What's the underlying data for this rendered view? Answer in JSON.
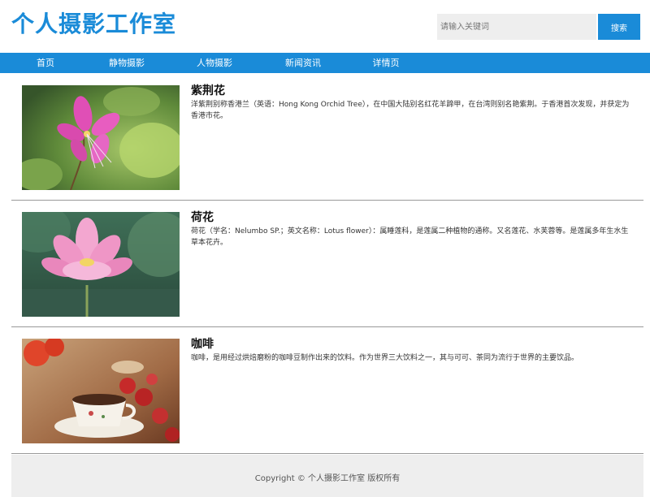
{
  "header": {
    "logo": "个人摄影工作室",
    "search": {
      "placeholder": "请输入关键词",
      "button_label": "搜索"
    }
  },
  "nav": {
    "items": [
      {
        "label": "首页"
      },
      {
        "label": "静物摄影"
      },
      {
        "label": "人物摄影"
      },
      {
        "label": "新闻资讯"
      },
      {
        "label": "详情页"
      }
    ]
  },
  "articles": [
    {
      "title": "紫荆花",
      "description": "洋紫荆别称香港兰（英语：Hong Kong Orchid Tree），在中国大陆别名红花羊蹄甲，在台湾则别名艳紫荆。于香港首次发现，并获定为香港市花。",
      "image_icon": "bauhinia-flower-photo"
    },
    {
      "title": "荷花",
      "description": "荷花（学名：Nelumbo SP.；英文名称：Lotus flower）：属睡莲科，是莲属二种植物的通称。又名莲花、水芙蓉等。是莲属多年生水生草本花卉。",
      "image_icon": "lotus-flower-photo"
    },
    {
      "title": "咖啡",
      "description": "咖啡，是用经过烘焙磨粉的咖啡豆制作出来的饮料。作为世界三大饮料之一，其与可可、茶同为流行于世界的主要饮品。",
      "image_icon": "coffee-cup-photo"
    }
  ],
  "footer": {
    "copyright": "Copyright © 个人摄影工作室 版权所有"
  },
  "colors": {
    "accent": "#1a8bd8",
    "footer_bg": "#eeeeee",
    "search_bg": "#eeeeee"
  }
}
